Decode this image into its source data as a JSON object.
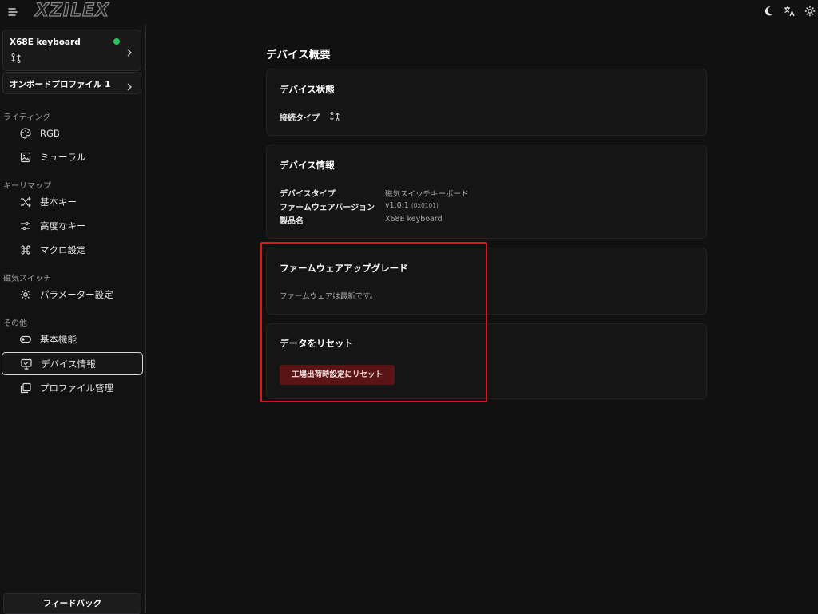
{
  "header": {
    "logo_text": "XZILEX",
    "icons": [
      "menu-icon",
      "moon-icon",
      "translate-icon",
      "gear-icon"
    ]
  },
  "sidebar": {
    "device": {
      "name": "X68E keyboard",
      "status_color": "#22c55e"
    },
    "profile": {
      "label": "オンボードプロファイル 1"
    },
    "sections": [
      {
        "title": "ライティング",
        "items": [
          {
            "label": "RGB",
            "icon": "palette-icon"
          },
          {
            "label": "ミューラル",
            "icon": "image-icon"
          }
        ]
      },
      {
        "title": "キーリマップ",
        "items": [
          {
            "label": "基本キー",
            "icon": "shuffle-icon"
          },
          {
            "label": "高度なキー",
            "icon": "sliders-icon"
          },
          {
            "label": "マクロ設定",
            "icon": "command-icon"
          }
        ]
      },
      {
        "title": "磁気スイッチ",
        "items": [
          {
            "label": "パラメーター設定",
            "icon": "gear-icon"
          }
        ]
      },
      {
        "title": "その他",
        "items": [
          {
            "label": "基本機能",
            "icon": "toggle-icon"
          },
          {
            "label": "デバイス情報",
            "icon": "monitor-icon",
            "active": true
          },
          {
            "label": "プロファイル管理",
            "icon": "copy-icon"
          }
        ]
      }
    ],
    "feedback_label": "フィードバック"
  },
  "main": {
    "title": "デバイス概要",
    "status_card": {
      "title": "デバイス状態",
      "connection_label": "接続タイプ"
    },
    "info_card": {
      "title": "デバイス情報",
      "rows": [
        {
          "label": "デバイスタイプ",
          "value": "磁気スイッチキーボード"
        },
        {
          "label": "ファームウェアバージョン",
          "value": "v1.0.1",
          "value_suffix": "(0x0101)"
        },
        {
          "label": "製品名",
          "value": "X68E keyboard"
        }
      ]
    },
    "firmware_card": {
      "title": "ファームウェアアップグレード",
      "message": "ファームウェアは最新です。"
    },
    "reset_card": {
      "title": "データをリセット",
      "button_label": "工場出荷時設定にリセット"
    }
  },
  "colors": {
    "background": "#111112",
    "card": "#151516",
    "accent_red": "#e01515",
    "reset_button": "#5a1416"
  }
}
